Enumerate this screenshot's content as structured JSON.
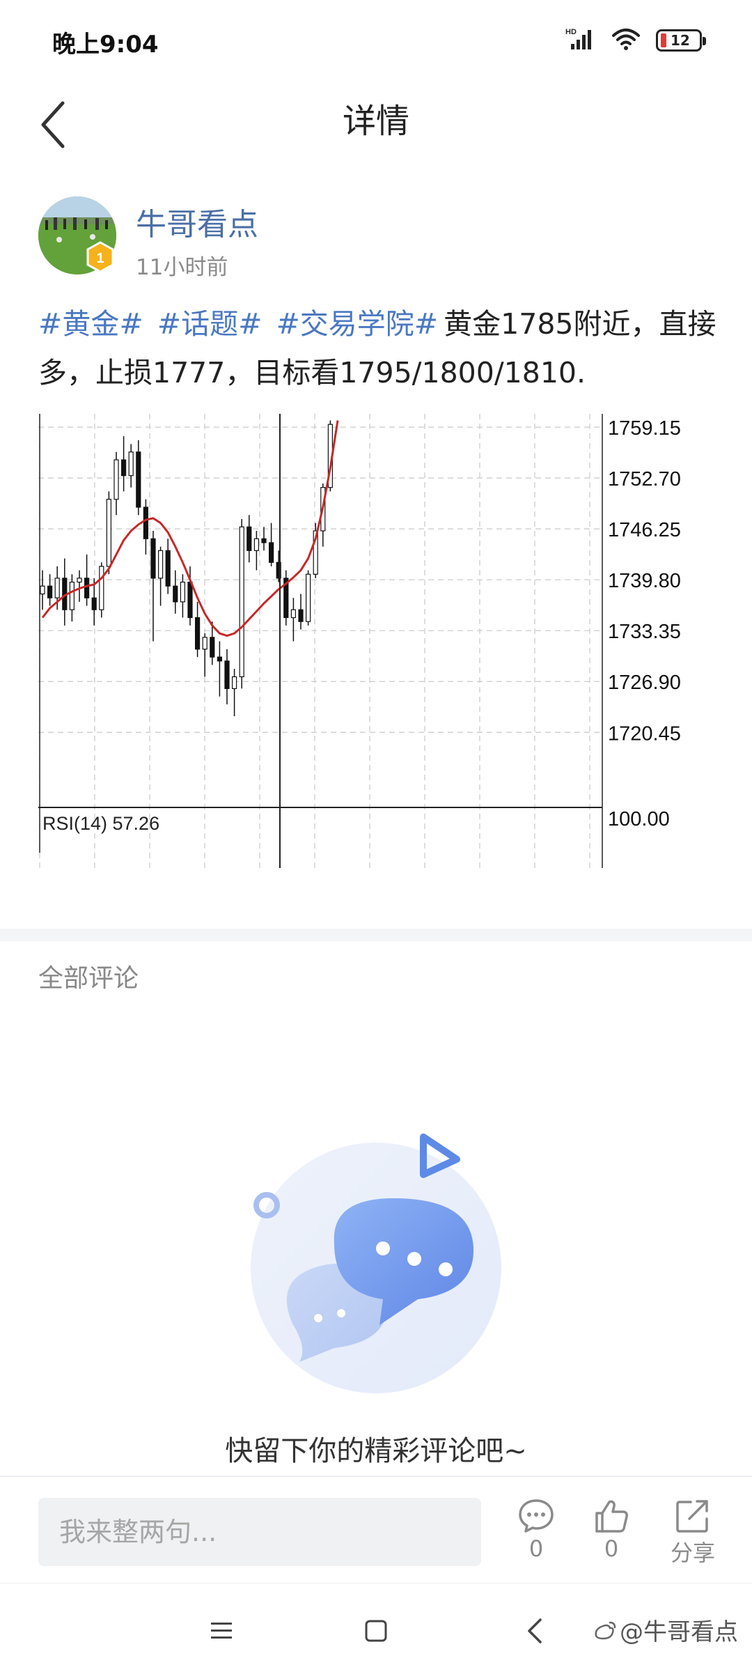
{
  "status_bar": {
    "time": "晚上9:04",
    "network": "HD",
    "battery": "12"
  },
  "nav": {
    "title": "详情"
  },
  "post": {
    "author": "牛哥看点",
    "time": "11小时前",
    "level": "1",
    "hashtags": [
      "#黄金#",
      "#话题#",
      "#交易学院#"
    ],
    "text": "黄金1785附近，直接多，止损1777，目标看1795/1800/1810."
  },
  "chart_data": {
    "type": "candlestick",
    "y_ticks": [
      "1759.15",
      "1752.70",
      "1746.25",
      "1739.80",
      "1733.35",
      "1726.90",
      "1720.45"
    ],
    "indicator_label": "RSI(14) 57.26",
    "indicator_tick": "100.00",
    "candles": [
      [
        1738.0,
        1741.0,
        1736.0,
        1739.0
      ],
      [
        1739.0,
        1740.5,
        1736.5,
        1737.5
      ],
      [
        1737.5,
        1741.5,
        1736.0,
        1740.0
      ],
      [
        1740.0,
        1742.5,
        1734.0,
        1736.0
      ],
      [
        1736.0,
        1740.5,
        1734.5,
        1739.5
      ],
      [
        1739.5,
        1741.0,
        1737.0,
        1740.0
      ],
      [
        1740.0,
        1743.0,
        1736.5,
        1737.5
      ],
      [
        1737.5,
        1740.0,
        1734.0,
        1736.0
      ],
      [
        1736.0,
        1742.0,
        1735.0,
        1741.5
      ],
      [
        1741.5,
        1751.0,
        1740.5,
        1750.0
      ],
      [
        1750.0,
        1756.0,
        1748.0,
        1755.0
      ],
      [
        1755.0,
        1758.0,
        1751.0,
        1753.0
      ],
      [
        1753.0,
        1757.0,
        1751.5,
        1756.0
      ],
      [
        1756.0,
        1757.5,
        1748.0,
        1749.0
      ],
      [
        1749.0,
        1750.0,
        1743.0,
        1745.0
      ],
      [
        1745.0,
        1746.0,
        1732.0,
        1740.0
      ],
      [
        1740.0,
        1744.0,
        1736.5,
        1743.5
      ],
      [
        1743.5,
        1745.0,
        1738.0,
        1739.0
      ],
      [
        1739.0,
        1741.0,
        1735.5,
        1737.0
      ],
      [
        1737.0,
        1740.5,
        1735.0,
        1739.5
      ],
      [
        1739.5,
        1741.5,
        1734.0,
        1735.0
      ],
      [
        1735.0,
        1737.0,
        1730.0,
        1731.0
      ],
      [
        1731.0,
        1733.0,
        1727.5,
        1732.5
      ],
      [
        1732.5,
        1734.5,
        1729.0,
        1730.0
      ],
      [
        1730.0,
        1732.0,
        1725.0,
        1729.5
      ],
      [
        1729.5,
        1731.0,
        1724.0,
        1726.0
      ],
      [
        1726.0,
        1728.5,
        1722.5,
        1727.5
      ],
      [
        1727.5,
        1747.5,
        1726.0,
        1746.5
      ],
      [
        1746.5,
        1748.0,
        1742.0,
        1743.5
      ],
      [
        1743.5,
        1746.0,
        1741.0,
        1745.0
      ],
      [
        1745.0,
        1746.5,
        1743.5,
        1744.5
      ],
      [
        1744.5,
        1747.0,
        1741.5,
        1742.0
      ],
      [
        1742.0,
        1743.5,
        1739.5,
        1740.0
      ],
      [
        1740.0,
        1741.0,
        1734.0,
        1735.0
      ],
      [
        1735.0,
        1737.5,
        1732.0,
        1736.0
      ],
      [
        1736.0,
        1738.0,
        1733.5,
        1734.5
      ],
      [
        1734.5,
        1741.0,
        1734.0,
        1740.5
      ],
      [
        1740.5,
        1747.0,
        1740.0,
        1746.0
      ],
      [
        1746.0,
        1752.0,
        1744.0,
        1751.5
      ],
      [
        1751.5,
        1760.0,
        1751.0,
        1759.5
      ]
    ],
    "ma": [
      1735.0,
      1736.2,
      1737.0,
      1737.8,
      1738.3,
      1738.7,
      1739.0,
      1739.2,
      1740.0,
      1741.2,
      1743.0,
      1744.8,
      1746.0,
      1746.8,
      1747.4,
      1747.6,
      1747.0,
      1745.8,
      1744.0,
      1742.0,
      1739.8,
      1737.5,
      1735.5,
      1734.0,
      1733.0,
      1732.7,
      1733.0,
      1733.8,
      1734.8,
      1735.8,
      1736.8,
      1737.7,
      1738.6,
      1739.3,
      1740.1,
      1741.0,
      1742.5,
      1745.0,
      1749.0,
      1754.0,
      1760.0
    ]
  },
  "comments": {
    "title": "全部评论",
    "empty_text": "快留下你的精彩评论吧~"
  },
  "bottom_bar": {
    "placeholder": "我来整两句...",
    "comment_count": "0",
    "like_count": "0",
    "share_label": "分享"
  },
  "watermark": {
    "text": "@牛哥看点"
  }
}
